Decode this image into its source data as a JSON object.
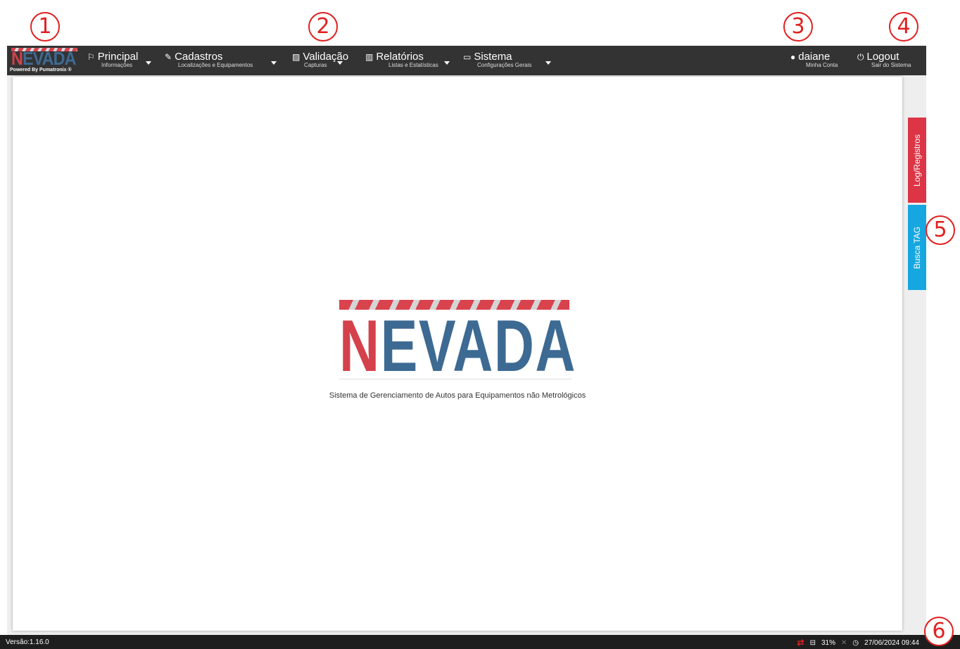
{
  "annotations": [
    "1",
    "2",
    "3",
    "4",
    "5",
    "6"
  ],
  "brand": {
    "name": "NEVADA",
    "name_first": "N",
    "name_rest": "EVADA",
    "powered_by": "Powered By Pumatronix ®"
  },
  "nav": [
    {
      "icon": "flag-icon",
      "label": "Principal",
      "sub": "Informações"
    },
    {
      "icon": "edit-icon",
      "label": "Cadastros",
      "sub": "Localizações e Equipamentos"
    },
    {
      "icon": "image-icon",
      "label": "Validação",
      "sub": "Capturas"
    },
    {
      "icon": "bar-chart-icon",
      "label": "Relatórios",
      "sub": "Listas e Estatísticas"
    },
    {
      "icon": "monitor-icon",
      "label": "Sistema",
      "sub": "Configurações Gerais"
    }
  ],
  "user": {
    "icon": "user-icon",
    "name": "daiane",
    "sub": "Minha Conta"
  },
  "logout": {
    "icon": "power-icon",
    "label": "Logout",
    "sub": "Sair do Sistema"
  },
  "main": {
    "logo_first": "N",
    "logo_rest": "EVADA",
    "tagline": "Sistema de Gerenciamento de Autos para Equipamentos não Metrológicos"
  },
  "side_tabs": {
    "log": "Log/Registros",
    "tag": "Busca TAG"
  },
  "colors": {
    "navbar": "#333333",
    "brand_blue": "#3d6a93",
    "brand_red": "#d4414b",
    "tab_log": "#dc3545",
    "tab_tag": "#17a7e0"
  },
  "footer": {
    "version": "Versão:1.16.0",
    "disk": "31%",
    "datetime": "27/06/2024 09:44",
    "icons": [
      "sync-icon",
      "hdd-icon",
      "mute-icon",
      "clock-icon"
    ]
  }
}
